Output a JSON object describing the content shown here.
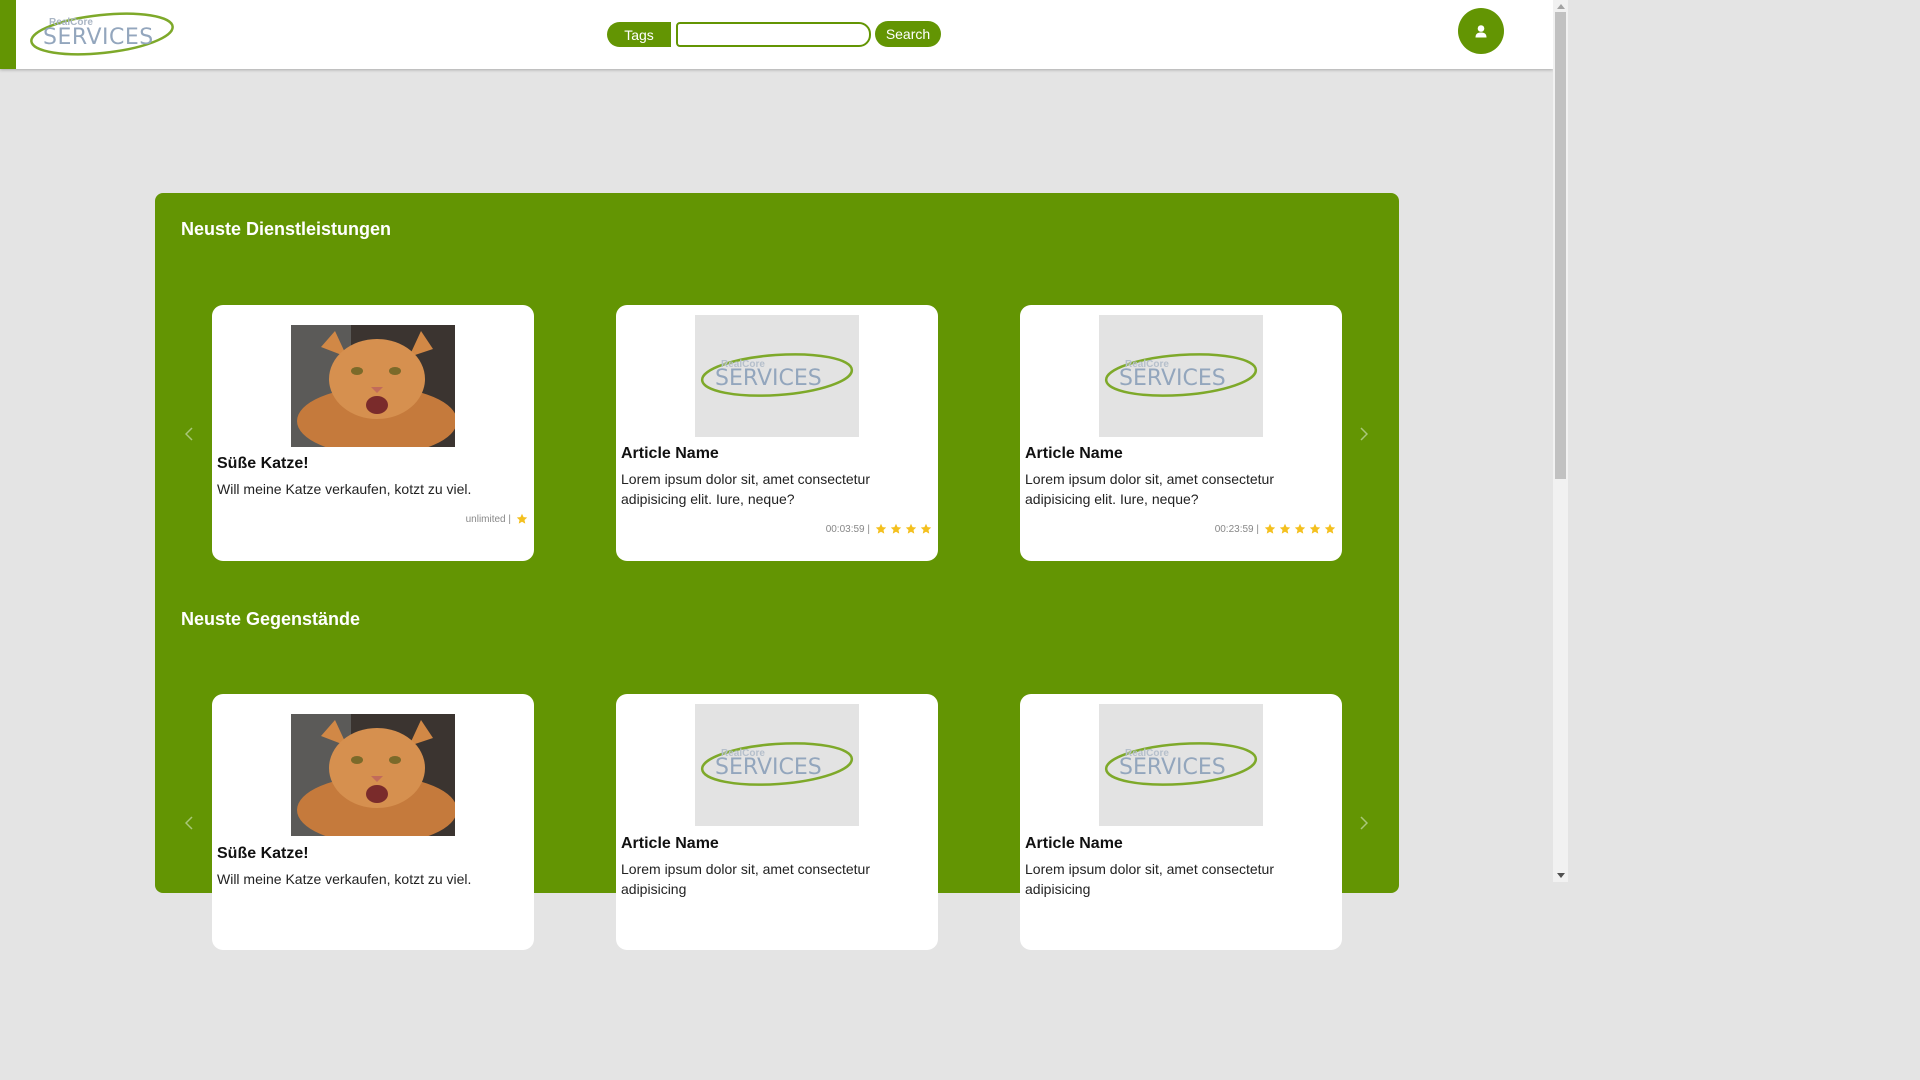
{
  "header": {
    "logo": {
      "line1": "RealCore",
      "line2": "SERVICES"
    },
    "tags_label": "Tags",
    "search_value": "",
    "search_label": "Search",
    "user_icon": "user-icon"
  },
  "colors": {
    "brand": "#639503",
    "background": "#e4e4e4",
    "star": "#f4c01e"
  },
  "sections": [
    {
      "title": "Neuste Dienstleistungen",
      "cards": [
        {
          "title": "Süße Katze!",
          "description": "Will meine Katze verkaufen, kotzt zu viel.",
          "meta": "unlimited |",
          "rating": 1,
          "image": "cat-photo"
        },
        {
          "title": "Article Name",
          "description": "Lorem ipsum dolor sit, amet consectetur adipisicing elit. Iure, neque?",
          "meta": "00:03:59 |",
          "rating": 4,
          "image": "logo-placeholder"
        },
        {
          "title": "Article Name",
          "description": "Lorem ipsum dolor sit, amet consectetur adipisicing elit. Iure, neque?",
          "meta": "00:23:59 |",
          "rating": 5,
          "image": "logo-placeholder"
        }
      ]
    },
    {
      "title": "Neuste Gegenstände",
      "cards": [
        {
          "title": "Süße Katze!",
          "description": "Will meine Katze verkaufen, kotzt zu viel.",
          "meta": "",
          "rating": 0,
          "image": "cat-photo"
        },
        {
          "title": "Article Name",
          "description": "Lorem ipsum dolor sit, amet consectetur adipisicing",
          "meta": "",
          "rating": 0,
          "image": "logo-placeholder"
        },
        {
          "title": "Article Name",
          "description": "Lorem ipsum dolor sit, amet consectetur adipisicing",
          "meta": "",
          "rating": 0,
          "image": "logo-placeholder"
        }
      ]
    }
  ]
}
